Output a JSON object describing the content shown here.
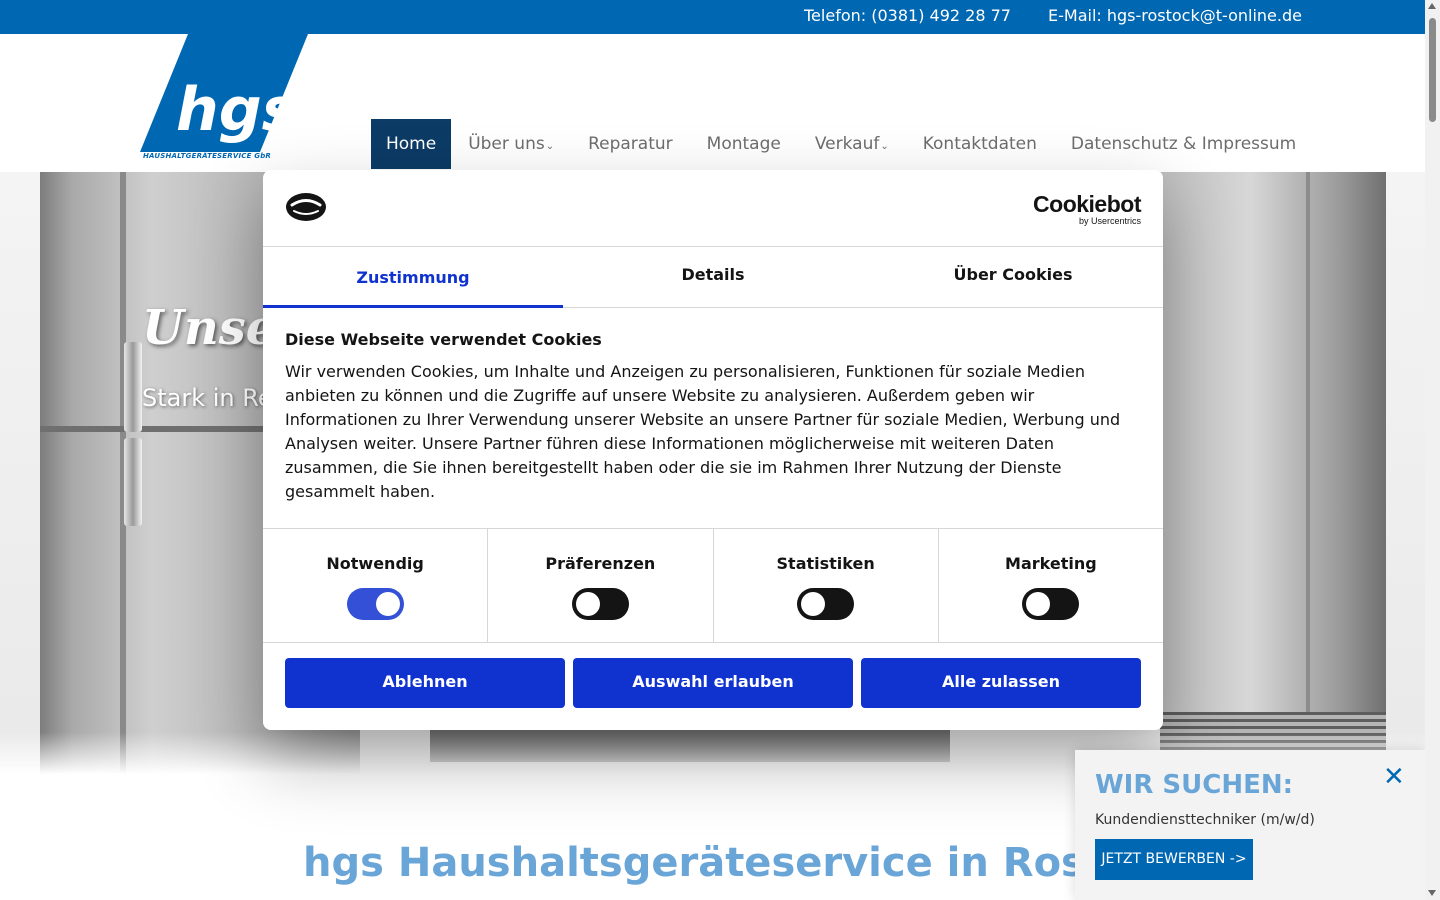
{
  "topbar": {
    "phone": "Telefon: (0381) 492 28 77",
    "email": "E-Mail: hgs-rostock@t-online.de"
  },
  "logo": {
    "text": "hgs",
    "subtitle": "HAUSHALTGERÄTESERVICE GbR"
  },
  "nav": {
    "items": [
      {
        "label": "Home",
        "active": true
      },
      {
        "label": "Über uns",
        "dropdown": true
      },
      {
        "label": "Reparatur"
      },
      {
        "label": "Montage"
      },
      {
        "label": "Verkauf",
        "dropdown": true
      },
      {
        "label": "Kontaktdaten"
      },
      {
        "label": "Datenschutz & Impressum"
      }
    ]
  },
  "hero": {
    "title": "Unser",
    "subtitle": "Stark in Re"
  },
  "page_heading": "hgs  Haushaltsgeräteservice in Rostoc",
  "cookie_dialog": {
    "brand": "Cookiebot",
    "brand_sub": "by Usercentrics",
    "tabs": [
      "Zustimmung",
      "Details",
      "Über Cookies"
    ],
    "active_tab": "Zustimmung",
    "heading": "Diese Webseite verwendet Cookies",
    "text": "Wir verwenden Cookies, um Inhalte und Anzeigen zu personalisieren, Funktionen für soziale Medien anbieten zu können und die Zugriffe auf unsere Website zu analysieren. Außerdem geben wir Informationen zu Ihrer Verwendung unserer Website an unsere Partner für soziale Medien, Werbung und Analysen weiter. Unsere Partner führen diese Informationen möglicherweise mit weiteren Daten zusammen, die Sie ihnen bereitgestellt haben oder die sie im Rahmen Ihrer Nutzung der Dienste gesammelt haben.",
    "toggles": [
      {
        "label": "Notwendig",
        "on": true
      },
      {
        "label": "Präferenzen",
        "on": false
      },
      {
        "label": "Statistiken",
        "on": false
      },
      {
        "label": "Marketing",
        "on": false
      }
    ],
    "buttons": {
      "decline": "Ablehnen",
      "allow_selection": "Auswahl erlauben",
      "allow_all": "Alle zulassen"
    }
  },
  "job_panel": {
    "title": "WIR SUCHEN:",
    "description": "Kundendiensttechniker (m/w/d)",
    "apply_label": "JETZT BEWERBEN ->",
    "close_icon": "close-icon"
  },
  "colors": {
    "topbar": "#0068b3",
    "nav_active": "#0c3b66",
    "cookie_accent": "#1032cf",
    "heading_blue": "#6aa5d7"
  }
}
